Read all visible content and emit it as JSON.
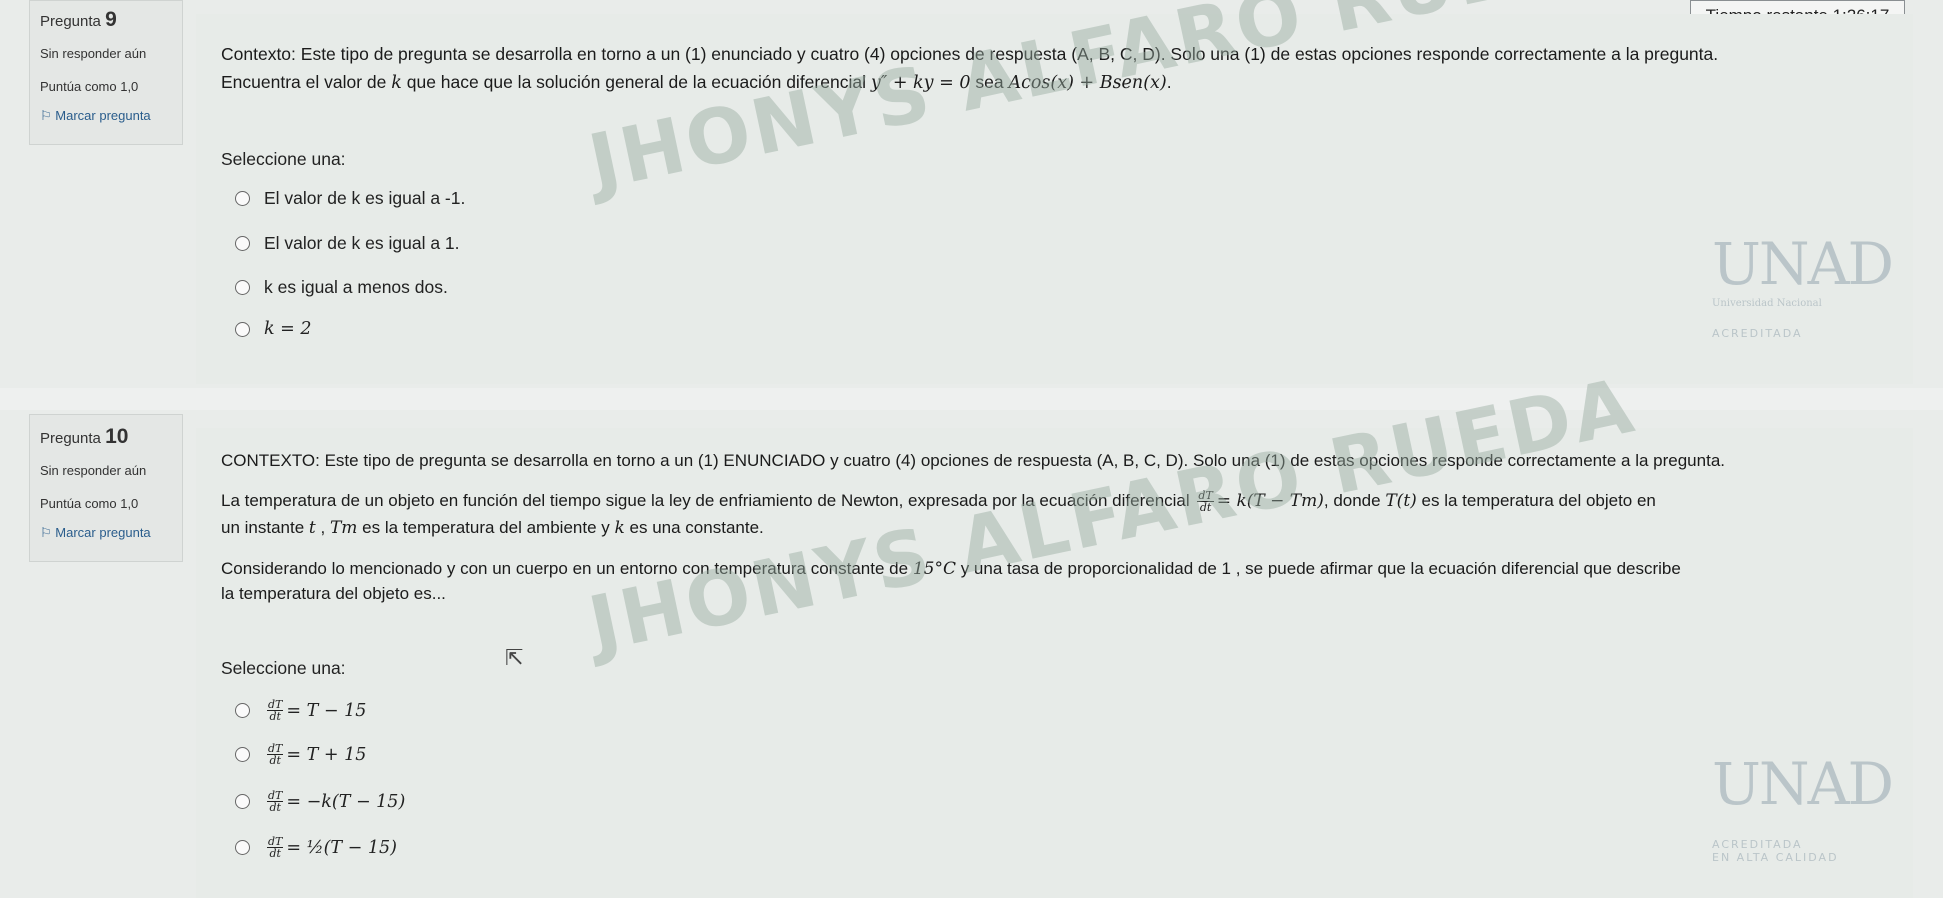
{
  "timer": "Tiempo restante 1:26:17",
  "q9": {
    "label": "Pregunta",
    "number": "9",
    "status": "Sin responder aún",
    "score": "Puntúa como 1,0",
    "flag": "Marcar pregunta",
    "context": "Contexto: Este tipo de pregunta se desarrolla en torno a un (1) enunciado y cuatro (4) opciones de respuesta (A, B, C, D). Solo una (1) de estas opciones responde correctamente a la pregunta.",
    "statement_prefix": "Encuentra el valor de",
    "statement_k": "k",
    "statement_mid": "que hace que la solución general de la ecuación diferencial",
    "statement_eq": "y″ + ky = 0",
    "statement_sea": "sea",
    "statement_sol": "Acos(x) + Bsen(x)",
    "statement_end": ".",
    "select": "Seleccione una:",
    "options": [
      "El valor de k es igual a -1.",
      "El valor de k es igual a 1.",
      "k es igual a menos dos.",
      "k = 2"
    ]
  },
  "q10": {
    "label": "Pregunta",
    "number": "10",
    "status": "Sin responder aún",
    "score": "Puntúa como 1,0",
    "flag": "Marcar pregunta",
    "context": "CONTEXTO: Este tipo de pregunta se desarrolla en torno a un (1) ENUNCIADO y cuatro (4) opciones de respuesta (A, B, C, D). Solo una (1) de estas opciones responde correctamente a la pregunta.",
    "line1_prefix": "La temperatura de un objeto en función del tiempo sigue la ley de enfriamiento de Newton, expresada por la ecuación diferencial",
    "line1_eq": "= k(T − Tm)",
    "line1_mid": ", donde",
    "line1_T": "T(t)",
    "line1_end": "es la temperatura del objeto en",
    "line2_prefix": "un instante",
    "line2_t": "t",
    "line2_sep": ",",
    "line2_Tm": "Tm",
    "line2_mid": "es la temperatura del ambiente y",
    "line2_k": "k",
    "line2_end": "es una constante.",
    "line3_prefix": "Considerando lo mencionado y con un cuerpo en un entorno con temperatura constante de",
    "line3_temp": "15°C",
    "line3_end": "y una tasa de proporcionalidad de 1 , se puede afirmar que la ecuación diferencial que describe",
    "line4": "la temperatura del objeto es...",
    "select": "Seleccione una:",
    "frac_num": "dT",
    "frac_den": "dt",
    "options": [
      "= T − 15",
      "= T + 15",
      "= −k(T − 15)",
      "= ½(T − 15)"
    ]
  },
  "watermark": "JHONYS ALFARO RUEDA",
  "logo": {
    "mark": "UNAD",
    "subtitle": "Universidad Nacional",
    "accr": "ACREDITADA",
    "accr2": "EN ALTA CALIDAD"
  }
}
